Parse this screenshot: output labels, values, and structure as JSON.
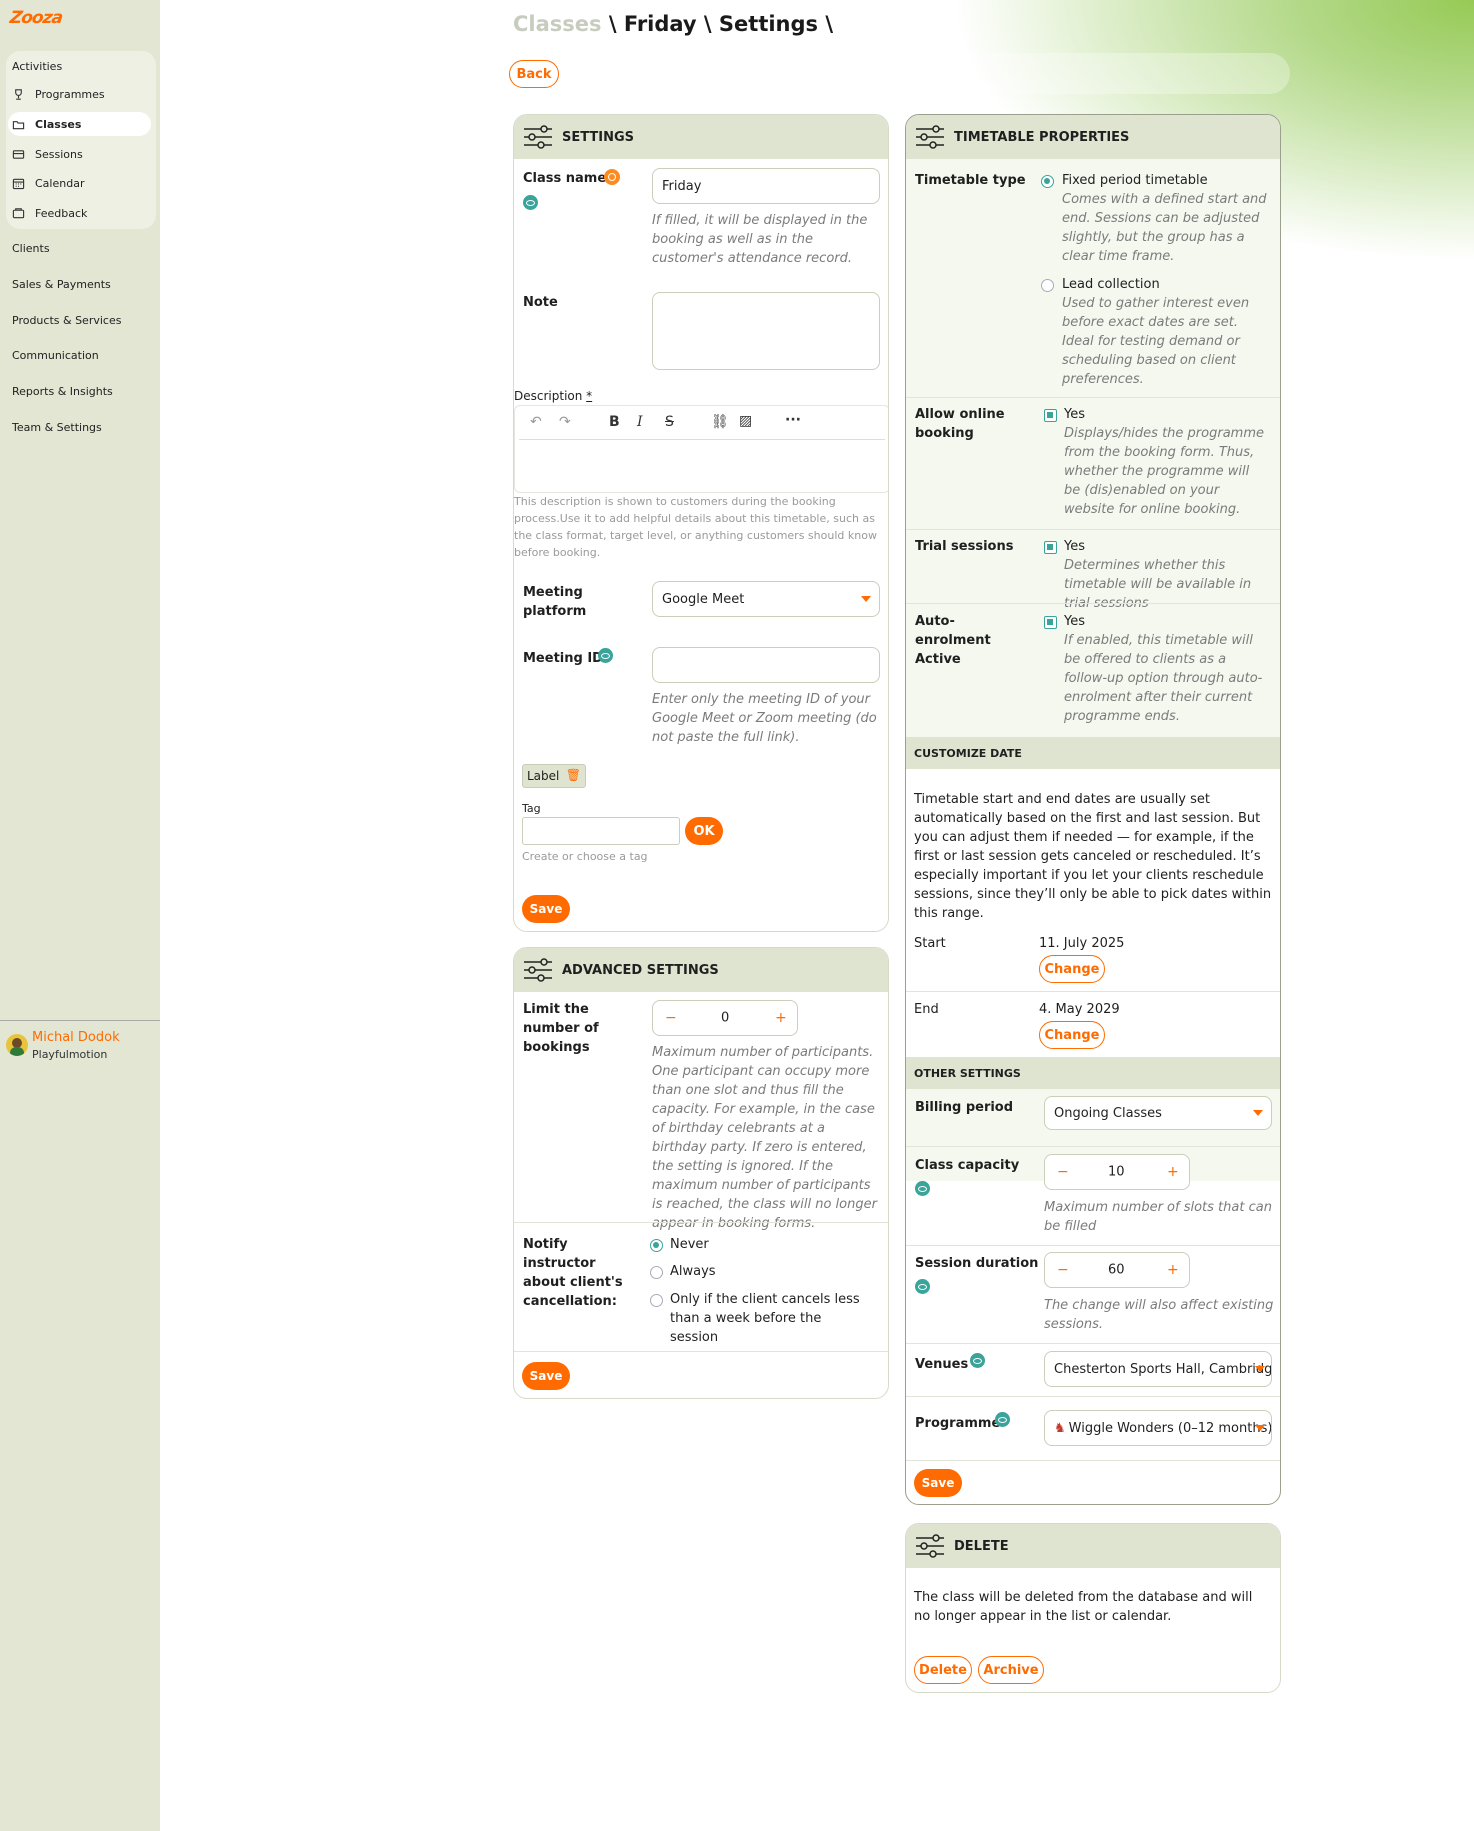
{
  "brand": {
    "logo": "Zooza"
  },
  "sidebar": {
    "section": "Activities",
    "items": [
      {
        "label": "Programmes"
      },
      {
        "label": "Classes"
      },
      {
        "label": "Sessions"
      },
      {
        "label": "Calendar"
      },
      {
        "label": "Feedback"
      }
    ],
    "nav": [
      "Clients",
      "Sales & Payments",
      "Products & Services",
      "Communication",
      "Reports & Insights",
      "Team & Settings"
    ],
    "user": {
      "name": "Michal Dodok",
      "org": "Playfulmotion"
    }
  },
  "header": {
    "crumb_muted": "Classes",
    "crumb_rest": " \\ Friday \\ Settings \\",
    "back": "Back"
  },
  "settings": {
    "title": "SETTINGS",
    "class_name_label": "Class name",
    "class_name_value": "Friday",
    "class_name_hint": "If filled, it will be displayed in the booking as well as in the customer's attendance record.",
    "note_label": "Note",
    "description_label": "Description",
    "description_required": "*",
    "description_hint": "This description is shown to customers during the booking process.Use it to add helpful details about this timetable, such as the class format, target level, or anything customers should know before booking.",
    "meeting_platform_label": "Meeting platform",
    "meeting_platform_value": "Google Meet",
    "meeting_id_label": "Meeting ID",
    "meeting_id_hint": "Enter only the meeting ID of your Google Meet or Zoom meeting (do not paste the full link).",
    "chip_label": "Label",
    "tag_label": "Tag",
    "tag_hint": "Create or choose a tag",
    "ok": "OK",
    "save": "Save"
  },
  "advanced": {
    "title": "ADVANCED SETTINGS",
    "limit_label": "Limit the number of bookings",
    "limit_value": "0",
    "limit_hint": "Maximum number of participants. One participant can occupy more than one slot and thus fill the capacity. For example, in the case of birthday celebrants at a birthday party. If zero is entered, the setting is ignored. If the maximum number of participants is reached, the class will no longer appear in booking forms.",
    "notify_label": "Notify instructor about client's cancellation:",
    "notify_options": [
      "Never",
      "Always",
      "Only if the client cancels less than a week before the session"
    ],
    "save": "Save"
  },
  "timetable": {
    "title": "TIMETABLE PROPERTIES",
    "type_label": "Timetable type",
    "fixed_label": "Fixed period timetable",
    "fixed_hint": "Comes with a defined start and end. Sessions can be adjusted slightly, but the group has a clear time frame.",
    "lead_label": "Lead collection",
    "lead_hint": "Used to gather interest even before exact dates are set. Ideal for testing demand or scheduling based on client preferences.",
    "online_label": "Allow online booking",
    "online_value": "Yes",
    "online_hint": "Displays/hides the programme from the booking form. Thus, whether the programme will be (dis)enabled on your website for online booking.",
    "trial_label": "Trial sessions",
    "trial_value": "Yes",
    "trial_hint": "Determines whether this timetable will be available in trial sessions",
    "auto_label": "Auto-enrolment Active",
    "auto_value": "Yes",
    "auto_hint": "If enabled, this timetable will be offered to clients as a follow-up option through auto-enrolment after their current programme ends.",
    "customize_title": "CUSTOMIZE DATE",
    "customize_text": "Timetable start and end dates are usually set automatically based on the first and last session. But you can adjust them if needed — for example, if the first or last session gets canceled or rescheduled. It’s especially important if you let your clients reschedule sessions, since they’ll only be able to pick dates within this range.",
    "start_label": "Start",
    "start_value": "11. July 2025",
    "end_label": "End",
    "end_value": "4. May 2029",
    "change": "Change",
    "other_title": "OTHER SETTINGS",
    "billing_label": "Billing period",
    "billing_value": "Ongoing Classes",
    "capacity_label": "Class capacity",
    "capacity_value": "10",
    "capacity_hint": "Maximum number of slots that can be filled",
    "duration_label": "Session duration",
    "duration_value": "60",
    "duration_hint": "The change will also affect existing sessions.",
    "venues_label": "Venues",
    "venues_value": "Chesterton Sports Hall, Cambridge",
    "programme_label": "Programme",
    "programme_value": "Wiggle Wonders (0–12 months)",
    "save": "Save"
  },
  "delete": {
    "title": "DELETE",
    "text": "The class will be deleted from the database and will no longer appear in the list or calendar.",
    "delete": "Delete",
    "archive": "Archive"
  },
  "colors": {
    "accent": "#ff6b00",
    "teal": "#3aa39a",
    "sidebar": "#e2e6d3",
    "card_header": "#dfe4d0"
  }
}
